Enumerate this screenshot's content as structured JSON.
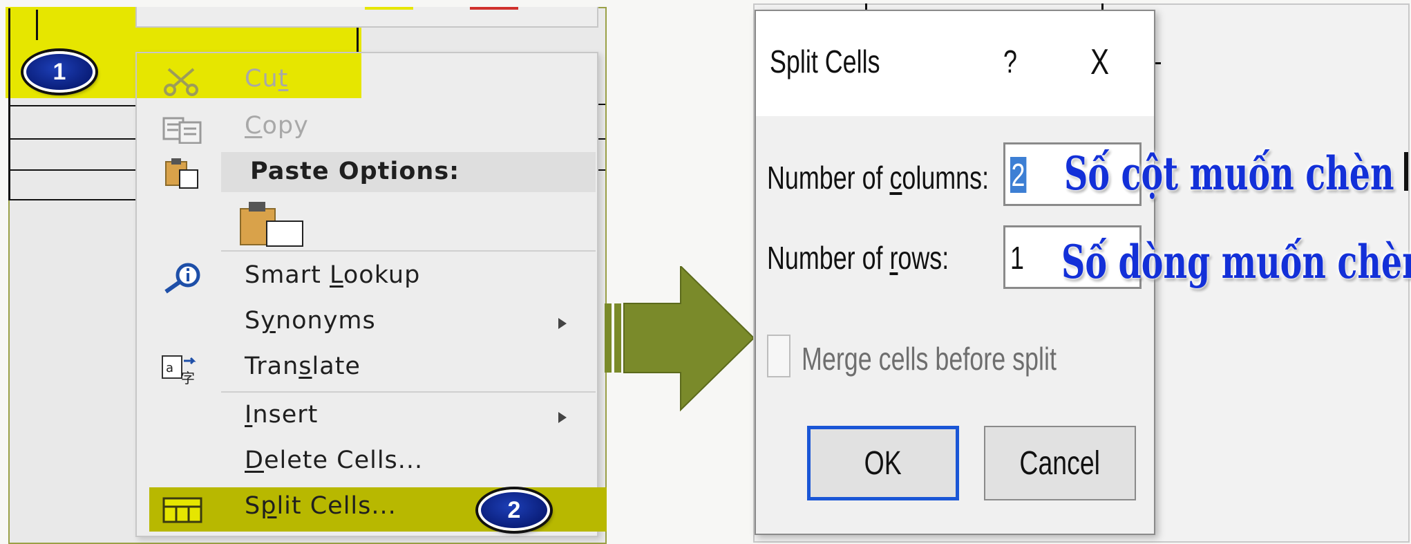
{
  "colors": {
    "selection_yellow": "#e6e600",
    "split_highlight": "#b8b800",
    "badge_blue": "#0a1e7a",
    "arrow_green": "#7a8a2a",
    "annotation_blue": "#1330d8",
    "ok_border": "#1a56d6"
  },
  "badges": {
    "step1": "1",
    "step2": "2"
  },
  "context_menu": {
    "items": [
      {
        "label_before": "Cu",
        "mnemonic": "t",
        "label_after": "",
        "icon": "scissors-icon",
        "disabled": true
      },
      {
        "label_before": "",
        "mnemonic": "C",
        "label_after": "opy",
        "icon": "copy-icon",
        "disabled": true
      },
      {
        "label": "Paste Options:",
        "icon": "paste-icon",
        "header": true
      },
      {
        "icon": "paste-keep-icon"
      },
      {
        "label_before": "Smart ",
        "mnemonic": "L",
        "label_after": "ookup",
        "icon": "smart-lookup-icon"
      },
      {
        "label_before": "S",
        "mnemonic": "y",
        "label_after": "nonyms",
        "submenu": true
      },
      {
        "label_before": "Tran",
        "mnemonic": "s",
        "label_after": "late",
        "icon": "translate-icon"
      },
      {
        "label_before": "",
        "mnemonic": "I",
        "label_after": "nsert",
        "submenu": true
      },
      {
        "label_before": "",
        "mnemonic": "D",
        "label_after": "elete Cells...",
        "icon": ""
      },
      {
        "label_before": "S",
        "mnemonic": "p",
        "label_after": "lit Cells...",
        "icon": "split-cells-icon",
        "highlighted": true
      }
    ]
  },
  "dialog": {
    "title": "Split Cells",
    "help": "?",
    "close": "X",
    "columns_label_before": "Number of ",
    "columns_mnemonic": "c",
    "columns_label_after": "olumns:",
    "columns_value": "2",
    "rows_label_before": "Number of ",
    "rows_mnemonic": "r",
    "rows_label_after": "ows:",
    "rows_value": "1",
    "merge_label": "Merge cells before split",
    "ok": "OK",
    "cancel": "Cancel"
  },
  "annotations": {
    "columns": "Số cột muốn chèn",
    "rows": "Số dòng muốn chèn"
  }
}
